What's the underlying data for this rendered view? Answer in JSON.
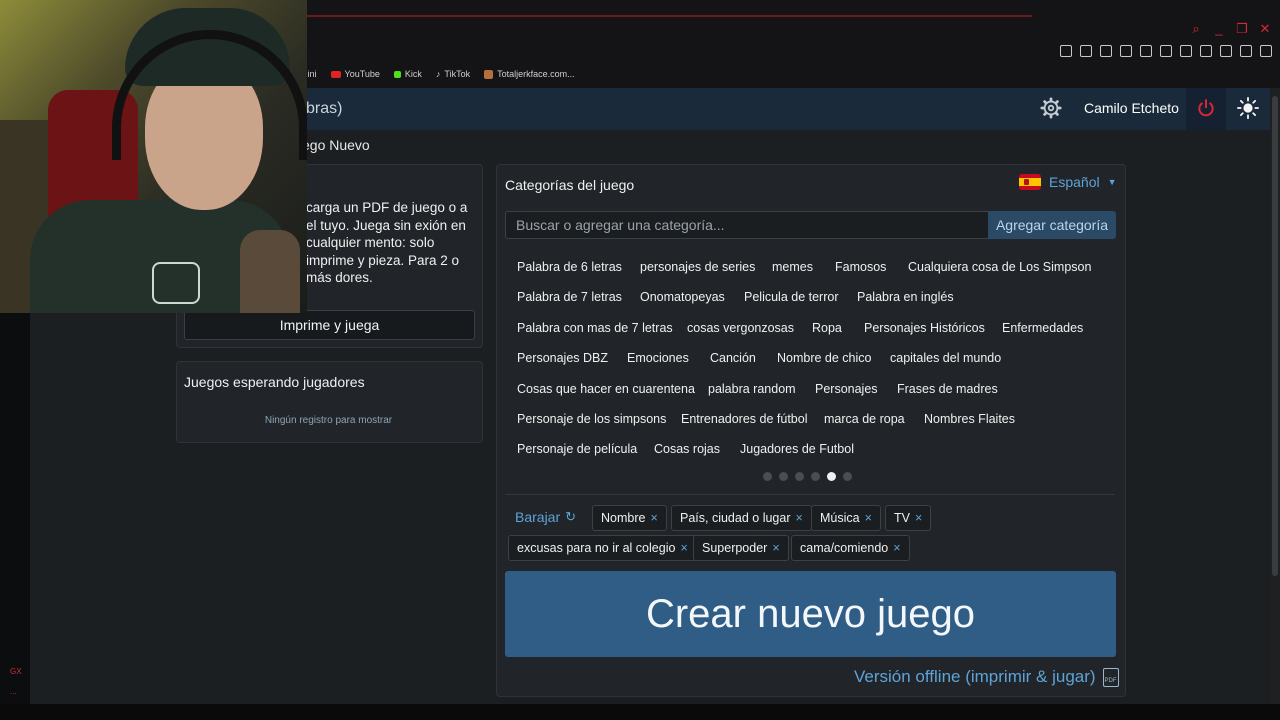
{
  "browser": {
    "bookmarks": [
      "mini",
      "YouTube",
      "Kick",
      "TikTok",
      "Totaljerkface.com..."
    ],
    "side_marks": [
      "GX",
      "..."
    ]
  },
  "header": {
    "title_partial": "bras)",
    "user_name": "Camilo Etcheto"
  },
  "breadcrumb": "ego Nuevo",
  "left_panel": {
    "description": "carga un PDF de juego o a el tuyo. Juega sin exión en cualquier mento: solo imprime y pieza. Para 2 o más dores.",
    "print_button": "Imprime y juega",
    "waiting_title": "Juegos esperando jugadores",
    "waiting_empty": "Ningún registro para mostrar"
  },
  "categories": {
    "title": "Categorías del juego",
    "language": "Español",
    "search_placeholder": "Buscar o agregar una categoría...",
    "add_button": "Agregar categoría",
    "suggestions": [
      "Palabra de 6 letras",
      "personajes de series",
      "memes",
      "Famosos",
      "Cualquiera cosa de Los Simpson",
      "Palabra de 7 letras",
      "Onomatopeyas",
      "Pelicula de terror",
      "Palabra en inglés",
      "Palabra con mas de 7 letras",
      "cosas vergonzosas",
      "Ropa",
      "Personajes Históricos",
      "Enfermedades",
      "Personajes DBZ",
      "Emociones",
      "Canción",
      "Nombre de chico",
      "capitales del mundo",
      "Cosas que hacer en cuarentena",
      "palabra random",
      "Personajes",
      "Frases de madres",
      "Personaje de los simpsons",
      "Entrenadores de fútbol",
      "marca de ropa",
      "Nombres Flaites",
      "Personaje de película",
      "Cosas rojas",
      "Jugadores de Futbol"
    ],
    "pagination": {
      "total": 6,
      "active": 5
    },
    "shuffle_label": "Barajar",
    "selected": [
      "Nombre",
      "País, ciudad o lugar",
      "Música",
      "TV",
      "excusas para no ir al colegio",
      "Superpoder",
      "cama/comiendo"
    ],
    "remove_symbol": "×",
    "create_button": "Crear nuevo juego",
    "offline_link": "Versión offline (imprimir & jugar)",
    "pdf_icon_text": "PDF"
  },
  "colors": {
    "accent": "#5da3d8",
    "header_bg": "#1a2a3a",
    "create_btn": "#2f5d86",
    "power": "#d8263a"
  }
}
